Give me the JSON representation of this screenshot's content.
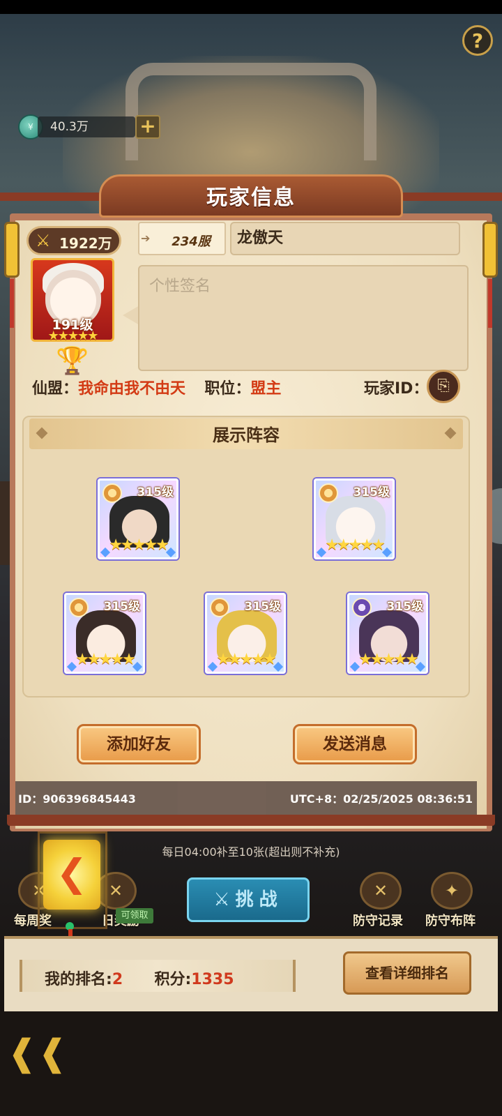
{
  "top": {
    "currency_icon": "coin-icon",
    "currency_value": "40.3万",
    "plus": "+",
    "help": "?"
  },
  "panel": {
    "title": "玩家信息",
    "power": "1922万",
    "avatar_level": "191级",
    "avatar_stars": "★★★★★",
    "server": "234服",
    "player_name": "龙傲天",
    "signature_placeholder": "个性签名",
    "guild_label": "仙盟：",
    "guild_value": "我命由我不由天",
    "position_label": "职位：",
    "position_value": "盟主",
    "player_id_label": "玩家ID：",
    "lineup_title": "展示阵容",
    "heroes": [
      {
        "level": "315级",
        "stars": "★★★★★"
      },
      {
        "level": "315级",
        "stars": "★★★★★"
      },
      {
        "level": "315级",
        "stars": "★★★★★"
      },
      {
        "level": "315级",
        "stars": "★★★★★"
      },
      {
        "level": "315级",
        "stars": "★★★★★"
      }
    ],
    "add_friend": "添加好友",
    "send_message": "发送消息",
    "footer_id": "ID：906396845443",
    "footer_time": "UTC+8：02/25/2025 08:36:51"
  },
  "lower": {
    "refill_note": "每日04:00补至10张(超出则不补充)",
    "weekly_label": "每周奖",
    "daily_label": "日奖励",
    "claim_tag": "可领取",
    "challenge": "挑战",
    "defense_record": "防守记录",
    "defense_lineup": "防守布阵",
    "my_rank_label": "我的排名:",
    "my_rank_value": "2",
    "score_label": "积分:",
    "score_value": "1335",
    "detail_button": "查看详细排名"
  }
}
